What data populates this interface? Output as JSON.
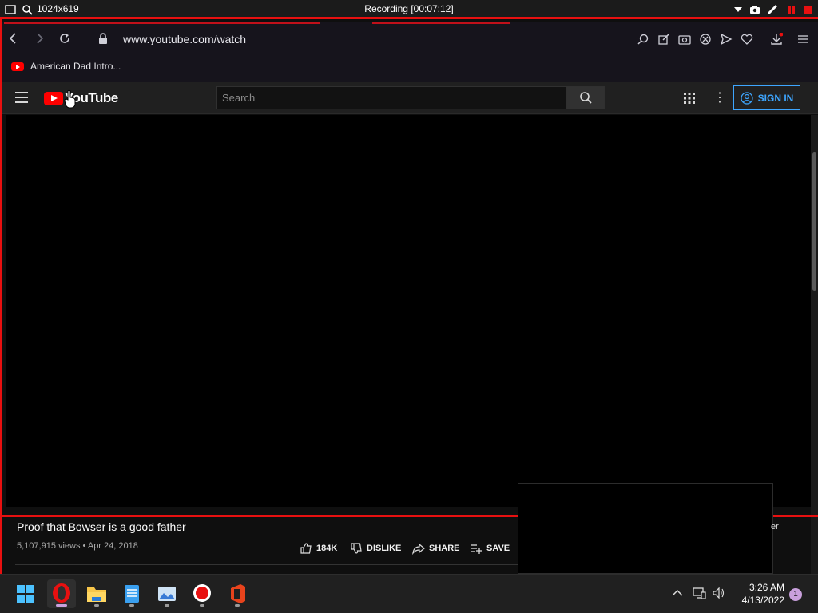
{
  "recorder": {
    "size_label": "1024x619",
    "title": "Recording [00:07:12]",
    "icons": [
      "window-icon",
      "magnifier-icon",
      "dropdown-icon",
      "camera-icon",
      "pen-icon",
      "pause-icon",
      "stop-icon"
    ]
  },
  "browser": {
    "url": "www.youtube.com/watch",
    "bookmark_label": "American Dad Intro..."
  },
  "youtube": {
    "logo_text": "YouTube",
    "search_placeholder": "Search",
    "sign_in_label": "SIGN IN"
  },
  "video": {
    "title": "Proof that Bowser is a good father",
    "meta": "5,107,915 views • Apr 24, 2018",
    "likes": "184K",
    "dislike_label": "DISLIKE",
    "share_label": "SHARE",
    "save_label": "SAVE",
    "overflow_text": "er"
  },
  "taskbar": {
    "time": "3:26 AM",
    "date": "4/13/2022",
    "notification_count": "1"
  },
  "colors": {
    "recording_red": "#e81010",
    "youtube_red": "#ff0000",
    "signin_blue": "#3ea6ff",
    "notification_purple": "#c9a0dc"
  }
}
